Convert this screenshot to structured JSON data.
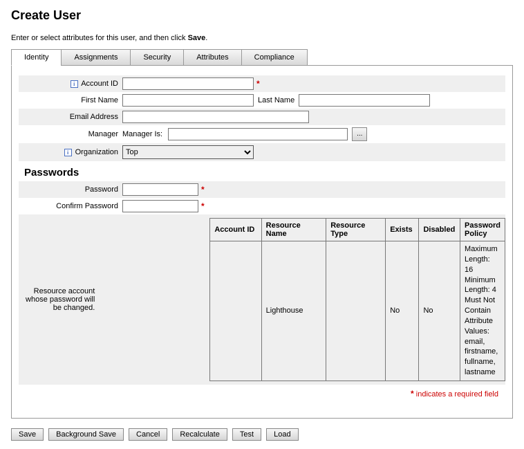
{
  "title": "Create User",
  "subtitle_prefix": "Enter or select attributes for this user, and then click ",
  "subtitle_bold": "Save",
  "subtitle_suffix": ".",
  "tabs": {
    "identity": "Identity",
    "assignments": "Assignments",
    "security": "Security",
    "attributes": "Attributes",
    "compliance": "Compliance"
  },
  "labels": {
    "account_id": "Account ID",
    "first_name": "First Name",
    "last_name": "Last Name",
    "email": "Email Address",
    "manager": "Manager",
    "manager_is": "Manager Is:",
    "organization": "Organization",
    "password": "Password",
    "confirm_password": "Confirm Password",
    "resource_desc": "Resource account whose password will be changed."
  },
  "values": {
    "account_id": "",
    "first_name": "",
    "last_name": "",
    "email": "",
    "manager": "",
    "organization": "Top",
    "password": "",
    "confirm_password": ""
  },
  "manager_browse": "...",
  "section_passwords": "Passwords",
  "table": {
    "headers": {
      "account_id": "Account ID",
      "resource_name": "Resource Name",
      "resource_type": "Resource Type",
      "exists": "Exists",
      "disabled": "Disabled",
      "password_policy": "Password Policy"
    },
    "row": {
      "account_id": "",
      "resource_name": "Lighthouse",
      "resource_type": "",
      "exists": "No",
      "disabled": "No",
      "password_policy": "Maximum Length: 16\nMinimum Length: 4\nMust Not Contain Attribute Values: email, firstname, fullname, lastname"
    }
  },
  "required_marker": "*",
  "required_note": " indicates a required field",
  "buttons": {
    "save": "Save",
    "bg_save": "Background Save",
    "cancel": "Cancel",
    "recalculate": "Recalculate",
    "test": "Test",
    "load": "Load"
  }
}
